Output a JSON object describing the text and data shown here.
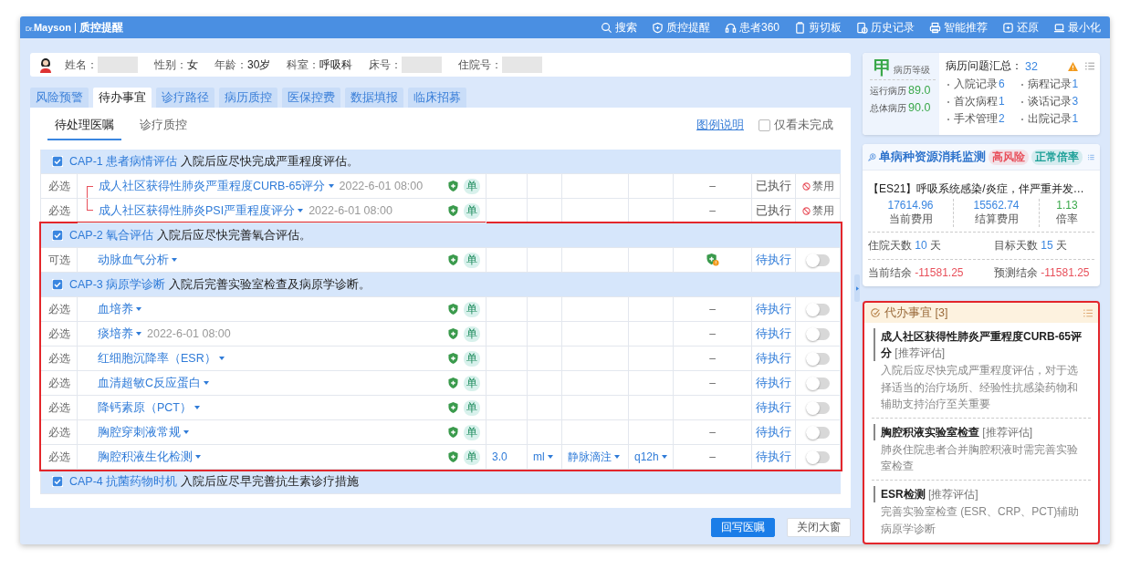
{
  "app": {
    "logo_prefix": "Dr.",
    "logo": "Mayson",
    "title": "质控提醒"
  },
  "nav": [
    {
      "label": "搜索",
      "kind": "search"
    },
    {
      "label": "质控提醒",
      "kind": "shield"
    },
    {
      "label": "患者360",
      "kind": "headset"
    },
    {
      "label": "剪切板",
      "kind": "clipboard"
    },
    {
      "label": "历史记录",
      "kind": "history"
    },
    {
      "label": "智能推荐",
      "kind": "printer"
    },
    {
      "label": "还原",
      "kind": "restore"
    },
    {
      "label": "最小化",
      "kind": "minimize"
    }
  ],
  "patient": {
    "fields": [
      {
        "label": "姓名：",
        "redacted": true
      },
      {
        "label": "性别：",
        "value": "女",
        "redacted": false
      },
      {
        "label": "年龄：",
        "value": "30岁",
        "redacted": false
      },
      {
        "label": "科室：",
        "value": "呼吸科",
        "redacted": false
      },
      {
        "label": "床号：",
        "redacted": true
      },
      {
        "label": "住院号：",
        "redacted": true
      }
    ]
  },
  "tabs": [
    {
      "label": "风险预警",
      "selected": false
    },
    {
      "label": "待办事宜",
      "selected": true
    },
    {
      "label": "诊疗路径",
      "selected": false
    },
    {
      "label": "病历质控",
      "selected": false
    },
    {
      "label": "医保控费",
      "selected": false
    },
    {
      "label": "数据填报",
      "selected": false
    },
    {
      "label": "临床招募",
      "selected": false
    }
  ],
  "subtabs": [
    {
      "label": "待处理医嘱",
      "selected": true
    },
    {
      "label": "诊疗质控",
      "selected": false
    }
  ],
  "legend_link": "图例说明",
  "filter": {
    "label": "仅看未完成",
    "checked": false
  },
  "groups": [
    {
      "code": "CAP-1",
      "title": "患者病情评估",
      "desc": "入院后应尽快完成严重程度评估。",
      "checked": true,
      "highlighted": false,
      "rows": [
        {
          "necessity": "必选",
          "name": "成人社区获得性肺炎严重程度CURB-65评分",
          "time": "2022-6-01 08:00",
          "linked": true,
          "order_type": "单",
          "column_7": "–",
          "warning": false,
          "status": "已执行",
          "executed": true,
          "action": {
            "kind": "ban",
            "label": "禁用"
          }
        },
        {
          "necessity": "必选",
          "name": "成人社区获得性肺炎PSI严重程度评分",
          "time": "2022-6-01 08:00",
          "linked": true,
          "order_type": "单",
          "column_7": "–",
          "warning": false,
          "status": "已执行",
          "executed": true,
          "action": {
            "kind": "ban",
            "label": "禁用"
          }
        }
      ]
    },
    {
      "code": "CAP-2",
      "title": "氧合评估",
      "desc": "入院后应尽快完善氧合评估。",
      "checked": true,
      "highlighted": true,
      "rows": [
        {
          "necessity": "可选",
          "name": "动脉血气分析",
          "linked": false,
          "order_type": "单",
          "warning": true,
          "status": "待执行",
          "executed": false,
          "action": {
            "kind": "toggle",
            "on": false
          }
        }
      ]
    },
    {
      "code": "CAP-3",
      "title": "病原学诊断",
      "desc": "入院后完善实验室检查及病原学诊断。",
      "checked": true,
      "highlighted": true,
      "rows": [
        {
          "necessity": "必选",
          "name": "血培养",
          "linked": false,
          "order_type": "单",
          "column_7": "–",
          "warning": false,
          "status": "待执行",
          "executed": false,
          "action": {
            "kind": "toggle",
            "on": false
          }
        },
        {
          "necessity": "必选",
          "name": "痰培养",
          "time": "2022-6-01 08:00",
          "linked": false,
          "order_type": "单",
          "column_7": "–",
          "warning": false,
          "status": "待执行",
          "executed": false,
          "action": {
            "kind": "toggle",
            "on": false
          }
        },
        {
          "necessity": "必选",
          "name": "红细胞沉降率（ESR）",
          "linked": false,
          "order_type": "单",
          "column_7": "–",
          "warning": false,
          "status": "待执行",
          "executed": false,
          "action": {
            "kind": "toggle",
            "on": false
          }
        },
        {
          "necessity": "必选",
          "name": "血清超敏C反应蛋白",
          "linked": false,
          "order_type": "单",
          "column_7": "–",
          "warning": false,
          "status": "待执行",
          "executed": false,
          "action": {
            "kind": "toggle",
            "on": false
          }
        },
        {
          "necessity": "必选",
          "name": "降钙素原（PCT）",
          "linked": false,
          "order_type": "单",
          "warning": false,
          "status": "待执行",
          "executed": false,
          "action": {
            "kind": "toggle",
            "on": false
          }
        },
        {
          "necessity": "必选",
          "name": "胸腔穿刺液常规",
          "linked": false,
          "order_type": "单",
          "column_7": "–",
          "warning": false,
          "status": "待执行",
          "executed": false,
          "action": {
            "kind": "toggle",
            "on": false
          }
        },
        {
          "necessity": "必选",
          "name": "胸腔积液生化检测",
          "linked": false,
          "order_type": "单",
          "dose": "3.0",
          "unit": "ml",
          "route": "静脉滴注",
          "freq": "q12h",
          "column_7": "–",
          "warning": false,
          "status": "待执行",
          "executed": false,
          "action": {
            "kind": "toggle",
            "on": false
          }
        }
      ]
    },
    {
      "code": "CAP-4",
      "title": "抗菌药物时机",
      "desc": "入院后应尽早完善抗生素诊疗措施",
      "checked": true,
      "highlighted": false
    }
  ],
  "buttons": [
    {
      "label": "回写医嘱",
      "kind": "primary"
    },
    {
      "label": "关闭大窗",
      "kind": "default"
    }
  ],
  "record_grade": {
    "grade": "甲",
    "label": "病历等级",
    "scores": [
      {
        "label": "运行病历",
        "value": "89.0"
      },
      {
        "label": "总体病历",
        "value": "90.0"
      }
    ]
  },
  "issues": {
    "title": "病历问题汇总：",
    "total": "32",
    "items": [
      {
        "label": "入院记录",
        "count": "6"
      },
      {
        "label": "病程记录",
        "count": "1"
      },
      {
        "label": "首次病程",
        "count": "1"
      },
      {
        "label": "谈话记录",
        "count": "3"
      },
      {
        "label": "手术管理",
        "count": "2"
      },
      {
        "label": "出院记录",
        "count": "1"
      }
    ]
  },
  "monitor": {
    "title": "单病种资源消耗监测",
    "tags": [
      {
        "label": "高风险",
        "color": "#e8505b"
      },
      {
        "label": "正常倍率",
        "color": "#1a9f96"
      }
    ],
    "drg": "【ES21】呼吸系统感染/炎症，伴严重并发…",
    "stats": [
      {
        "value": "17614.96",
        "label": "当前费用",
        "color": "#3a86e0"
      },
      {
        "value": "15562.74",
        "label": "结算费用",
        "color": "#3a86e0"
      },
      {
        "value": "1.13",
        "label": "倍率",
        "color": "#3aa84a"
      }
    ],
    "days": [
      {
        "label": "住院天数",
        "value": "10",
        "unit": "天"
      },
      {
        "label": "目标天数",
        "value": "15",
        "unit": "天"
      }
    ],
    "balances": [
      {
        "label": "当前结余",
        "value": "-11581.25"
      },
      {
        "label": "预测结余",
        "value": "-11581.25"
      }
    ]
  },
  "todo": {
    "title": "代办事宜",
    "count": "[3]",
    "highlighted": true,
    "items": [
      {
        "title": "成人社区获得性肺炎严重程度CURB-65评分",
        "tag": "[推荐评估]",
        "desc": "入院后应尽快完成严重程度评估，对于选择适当的治疗场所、经验性抗感染药物和辅助支持治疗至关重要"
      },
      {
        "title": "胸腔积液实验室检查",
        "tag": "[推荐评估]",
        "desc": "肺炎住院患者合并胸腔积液时需完善实验室检查"
      },
      {
        "title": "ESR检测",
        "tag": "[推荐评估]",
        "desc": "完善实验室检查 (ESR、CRP、PCT)辅助病原学诊断"
      }
    ]
  }
}
